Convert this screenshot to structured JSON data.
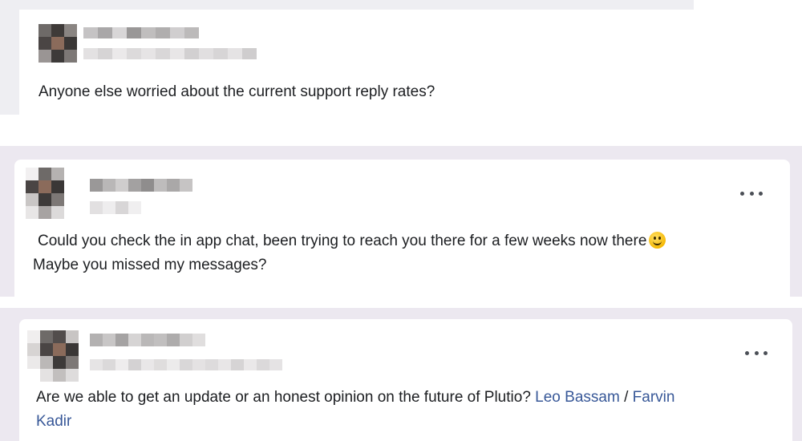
{
  "posts": [
    {
      "text": "Anyone else worried about the current support reply rates?"
    },
    {
      "menu_icon": "more-horizontal-icon",
      "text_line1": "Could you check the in app chat, been trying to reach you there for a few weeks now there",
      "emoji": "smiling-face-emoji",
      "text_line2": "Maybe you missed my messages?"
    },
    {
      "menu_icon": "more-horizontal-icon",
      "text_before": "Are we able to get an update or an honest opinion on the future of Plutio? ",
      "mention1": "Leo Bassam",
      "separator": " / ",
      "mention2_part1": "Farvin",
      "mention2_part2": "Kadir"
    }
  ],
  "colors": {
    "page_background": "#ece8f0",
    "card": "#ffffff",
    "mention": "#385898",
    "text": "#1c1e21"
  }
}
